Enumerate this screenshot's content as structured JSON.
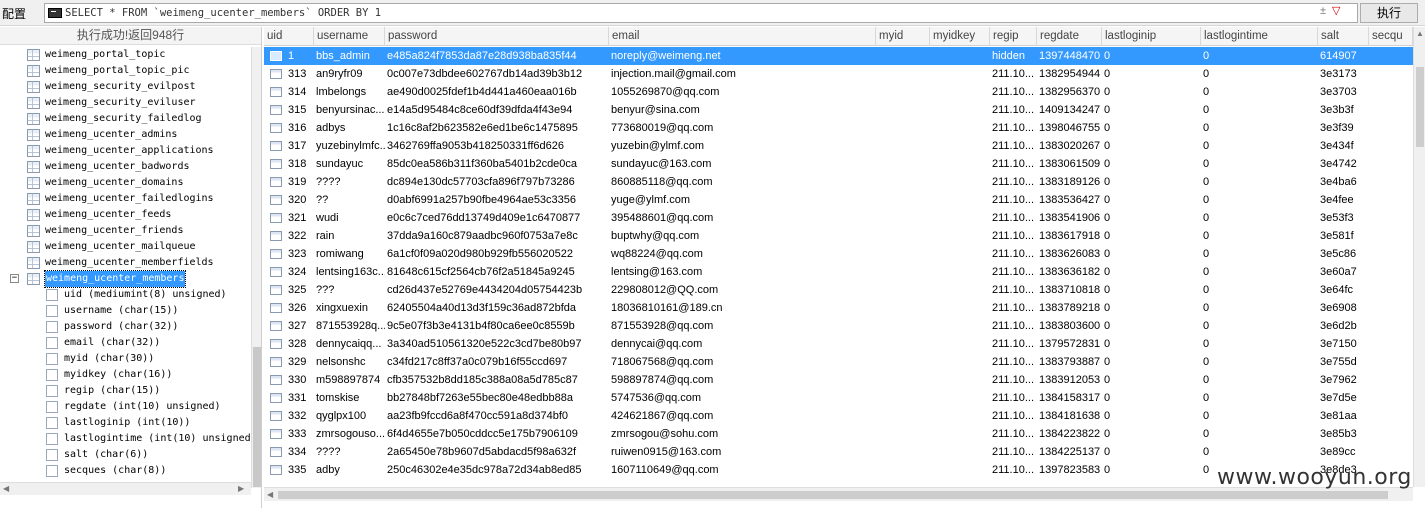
{
  "toolbar": {
    "config_label": "配置",
    "query": "SELECT * FROM `weimeng_ucenter_members` ORDER BY 1",
    "query_ctrl": "±",
    "query_ctrl_dd": "▽",
    "run_label": "执行"
  },
  "status": "执行成功!返回948行",
  "tree": {
    "tables": [
      "weimeng_portal_topic",
      "weimeng_portal_topic_pic",
      "weimeng_security_evilpost",
      "weimeng_security_eviluser",
      "weimeng_security_failedlog",
      "weimeng_ucenter_admins",
      "weimeng_ucenter_applications",
      "weimeng_ucenter_badwords",
      "weimeng_ucenter_domains",
      "weimeng_ucenter_failedlogins",
      "weimeng_ucenter_feeds",
      "weimeng_ucenter_friends",
      "weimeng_ucenter_mailqueue",
      "weimeng_ucenter_memberfields"
    ],
    "selected_table": "weimeng_ucenter_members",
    "expander": "−",
    "columns": [
      "uid (mediumint(8) unsigned)",
      "username (char(15))",
      "password (char(32))",
      "email (char(32))",
      "myid (char(30))",
      "myidkey (char(16))",
      "regip (char(15))",
      "regdate (int(10) unsigned)",
      "lastloginip (int(10))",
      "lastlogintime (int(10) unsigned",
      "salt (char(6))",
      "secques (char(8))"
    ]
  },
  "grid": {
    "headers": [
      "uid",
      "username",
      "password",
      "email",
      "myid",
      "myidkey",
      "regip",
      "regdate",
      "lastloginip",
      "lastlogintime",
      "salt",
      "secqu"
    ],
    "rows": [
      [
        "1",
        "bbs_admin",
        "e485a824f7853da87e28d938ba835f44",
        "noreply@weimeng.net",
        "",
        "",
        "hidden",
        "1397448470",
        "0",
        "0",
        "614907",
        ""
      ],
      [
        "313",
        "an9ryfr09",
        "0c007e73dbdee602767db14ad39b3b12",
        "injection.mail@gmail.com",
        "",
        "",
        "211.10...",
        "1382954944",
        "0",
        "0",
        "3e3173",
        ""
      ],
      [
        "314",
        "lmbelongs",
        "ae490d0025fdef1b4d441a460eaa016b",
        "1055269870@qq.com",
        "",
        "",
        "211.10...",
        "1382956370",
        "0",
        "0",
        "3e3703",
        ""
      ],
      [
        "315",
        "benyursinac...",
        "e14a5d95484c8ce60df39dfda4f43e94",
        "benyur@sina.com",
        "",
        "",
        "211.10...",
        "1409134247",
        "0",
        "0",
        "3e3b3f",
        ""
      ],
      [
        "316",
        "adbys",
        "1c16c8af2b623582e6ed1be6c1475895",
        "773680019@qq.com",
        "",
        "",
        "211.10...",
        "1398046755",
        "0",
        "0",
        "3e3f39",
        ""
      ],
      [
        "317",
        "yuzebinylmfc...",
        "3462769ffa9053b418250331ff6d626",
        "yuzebin@ylmf.com",
        "",
        "",
        "211.10...",
        "1383020267",
        "0",
        "0",
        "3e434f",
        ""
      ],
      [
        "318",
        "sundayuc",
        "85dc0ea586b311f360ba5401b2cde0ca",
        "sundayuc@163.com",
        "",
        "",
        "211.10...",
        "1383061509",
        "0",
        "0",
        "3e4742",
        ""
      ],
      [
        "319",
        "????",
        "dc894e130dc57703cfa896f797b73286",
        "860885118@qq.com",
        "",
        "",
        "211.10...",
        "1383189126",
        "0",
        "0",
        "3e4ba6",
        ""
      ],
      [
        "320",
        "??",
        "d0abf6991a257b90fbe4964ae53c3356",
        "yuge@ylmf.com",
        "",
        "",
        "211.10...",
        "1383536427",
        "0",
        "0",
        "3e4fee",
        ""
      ],
      [
        "321",
        "wudi",
        "e0c6c7ced76dd13749d409e1c6470877",
        "395488601@qq.com",
        "",
        "",
        "211.10...",
        "1383541906",
        "0",
        "0",
        "3e53f3",
        ""
      ],
      [
        "322",
        "rain",
        "37dda9a160c879aadbc960f0753a7e8c",
        "buptwhy@qq.com",
        "",
        "",
        "211.10...",
        "1383617918",
        "0",
        "0",
        "3e581f",
        ""
      ],
      [
        "323",
        "romiwang",
        "6a1cf0f09a020d980b929fb556020522",
        "wq88224@qq.com",
        "",
        "",
        "211.10...",
        "1383626083",
        "0",
        "0",
        "3e5c86",
        ""
      ],
      [
        "324",
        "lentsing163c...",
        "81648c615cf2564cb76f2a51845a9245",
        "lentsing@163.com",
        "",
        "",
        "211.10...",
        "1383636182",
        "0",
        "0",
        "3e60a7",
        ""
      ],
      [
        "325",
        "???",
        "cd26d437e52769e4434204d05754423b",
        "229808012@QQ.com",
        "",
        "",
        "211.10...",
        "1383710818",
        "0",
        "0",
        "3e64fc",
        ""
      ],
      [
        "326",
        "xingxuexin",
        "62405504a40d13d3f159c36ad872bfda",
        "18036810161@189.cn",
        "",
        "",
        "211.10...",
        "1383789218",
        "0",
        "0",
        "3e6908",
        ""
      ],
      [
        "327",
        "871553928q...",
        "9c5e07f3b3e4131b4f80ca6ee0c8559b",
        "871553928@qq.com",
        "",
        "",
        "211.10...",
        "1383803600",
        "0",
        "0",
        "3e6d2b",
        ""
      ],
      [
        "328",
        "dennycaiqq...",
        "3a340ad510561320e522c3cd7be80b97",
        "dennycai@qq.com",
        "",
        "",
        "211.10...",
        "1379572831",
        "0",
        "0",
        "3e7150",
        ""
      ],
      [
        "329",
        "nelsonshc",
        "c34fd217c8ff37a0c079b16f55ccd697",
        "718067568@qq.com",
        "",
        "",
        "211.10...",
        "1383793887",
        "0",
        "0",
        "3e755d",
        ""
      ],
      [
        "330",
        "m598897874",
        "cfb357532b8dd185c388a08a5d785c87",
        "598897874@qq.com",
        "",
        "",
        "211.10...",
        "1383912053",
        "0",
        "0",
        "3e7962",
        ""
      ],
      [
        "331",
        "tomskise",
        "bb27848bf7263e55bec80e48edbb88a",
        "5747536@qq.com",
        "",
        "",
        "211.10...",
        "1384158317",
        "0",
        "0",
        "3e7d5e",
        ""
      ],
      [
        "332",
        "qyglpx100",
        "aa23fb9fccd6a8f470cc591a8d374bf0",
        "424621867@qq.com",
        "",
        "",
        "211.10...",
        "1384181638",
        "0",
        "0",
        "3e81aa",
        ""
      ],
      [
        "333",
        "zmrsogouso...",
        "6f4d4655e7b050cddcc5e175b7906109",
        "zmrsogou@sohu.com",
        "",
        "",
        "211.10...",
        "1384223822",
        "0",
        "0",
        "3e85b3",
        ""
      ],
      [
        "334",
        "????",
        "2a65450e78b9607d5abdacd5f98a632f",
        "ruiwen0915@163.com",
        "",
        "",
        "211.10...",
        "1384225137",
        "0",
        "0",
        "3e89cc",
        ""
      ],
      [
        "335",
        "adby",
        "250c46302e4e35dc978a72d34ab8ed85",
        "1607110649@qq.com",
        "",
        "",
        "211.10...",
        "1397823583",
        "0",
        "0",
        "3e8de3",
        ""
      ]
    ]
  },
  "watermark": "www.wooyun.org"
}
